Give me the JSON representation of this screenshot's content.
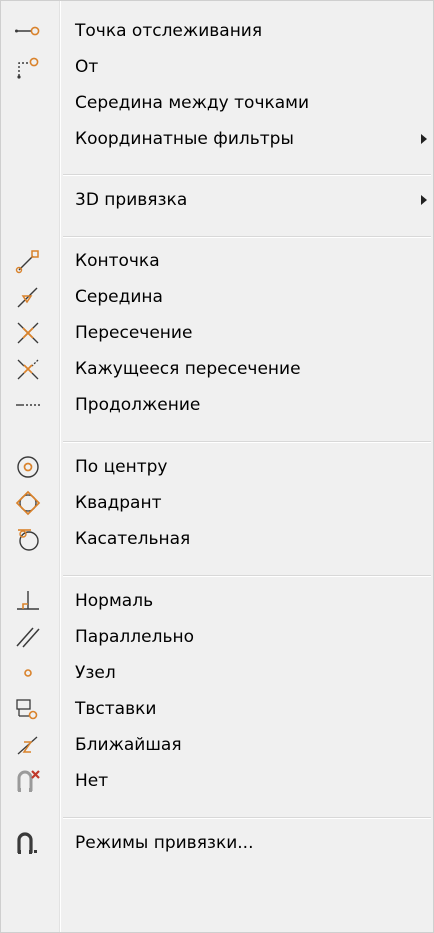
{
  "menu": {
    "items": [
      {
        "label": "Точка отслеживания",
        "icon": "tracking-point-icon"
      },
      {
        "label": "От",
        "icon": "from-icon"
      },
      {
        "label": "Середина между точками",
        "icon": ""
      },
      {
        "label": "Координатные фильтры",
        "icon": "",
        "submenu": true
      },
      {
        "label": "3D привязка",
        "icon": "",
        "submenu": true
      },
      {
        "label": "Конточка",
        "icon": "endpoint-icon"
      },
      {
        "label": "Середина",
        "icon": "midpoint-icon"
      },
      {
        "label": "Пересечение",
        "icon": "intersection-icon"
      },
      {
        "label": "Кажущееся пересечение",
        "icon": "apparent-intersection-icon"
      },
      {
        "label": "Продолжение",
        "icon": "extension-icon"
      },
      {
        "label": "По центру",
        "icon": "center-icon"
      },
      {
        "label": "Квадрант",
        "icon": "quadrant-icon"
      },
      {
        "label": "Касательная",
        "icon": "tangent-icon"
      },
      {
        "label": "Нормаль",
        "icon": "perpendicular-icon"
      },
      {
        "label": "Параллельно",
        "icon": "parallel-icon"
      },
      {
        "label": "Узел",
        "icon": "node-icon"
      },
      {
        "label": "Твставки",
        "icon": "insertion-icon"
      },
      {
        "label": "Ближайшая",
        "icon": "nearest-icon"
      },
      {
        "label": "Нет",
        "icon": "none-icon"
      },
      {
        "label": "Режимы привязки...",
        "icon": "osnap-settings-icon"
      }
    ]
  },
  "colors": {
    "background": "#f0f0f0",
    "snap_orange": "#d9822b",
    "icon_dark": "#3a3a3a"
  }
}
